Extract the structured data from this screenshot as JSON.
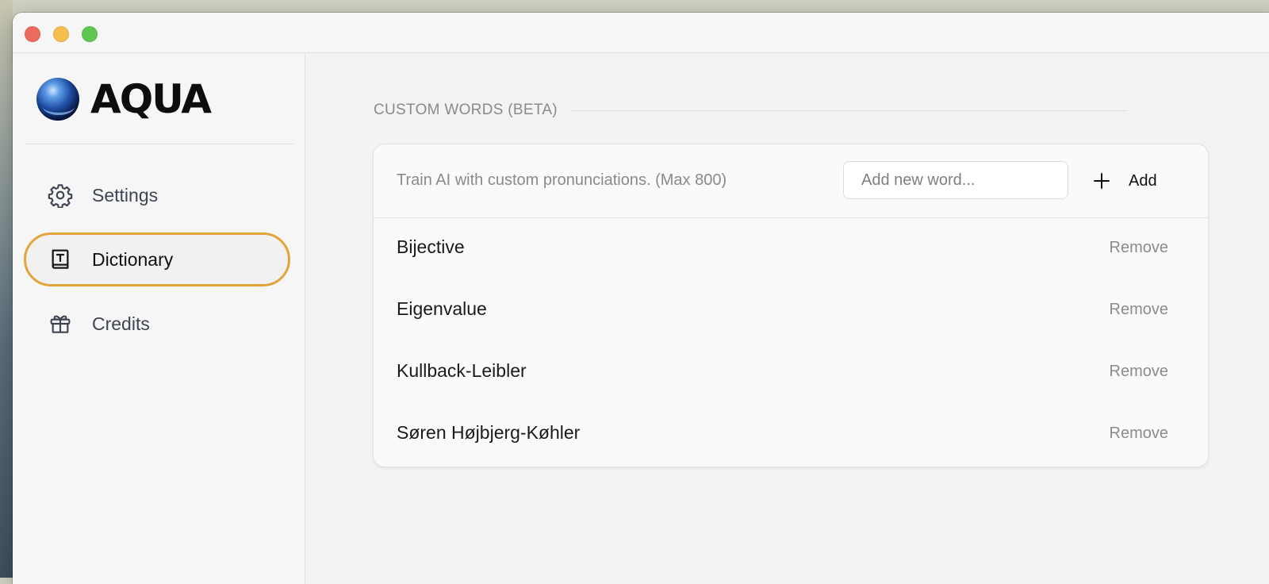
{
  "app": {
    "logo_text": "AQUA"
  },
  "sidebar": {
    "items": [
      {
        "label": "Settings",
        "icon": "gear-icon",
        "active": false
      },
      {
        "label": "Dictionary",
        "icon": "dictionary-icon",
        "active": true
      },
      {
        "label": "Credits",
        "icon": "gift-icon",
        "active": false
      }
    ]
  },
  "main": {
    "section_title": "CUSTOM WORDS (BETA)",
    "hint": "Train AI with custom pronunciations. (Max 800)",
    "input_placeholder": "Add new word...",
    "add_label": "Add",
    "remove_label": "Remove",
    "words": [
      "Bijective",
      "Eigenvalue",
      "Kullback-Leibler",
      "Søren Højbjerg-Køhler"
    ]
  },
  "colors": {
    "active_outline": "#e3a43a",
    "close": "#ec6a5e",
    "minimize": "#f4bf4f",
    "zoom": "#61c554"
  }
}
